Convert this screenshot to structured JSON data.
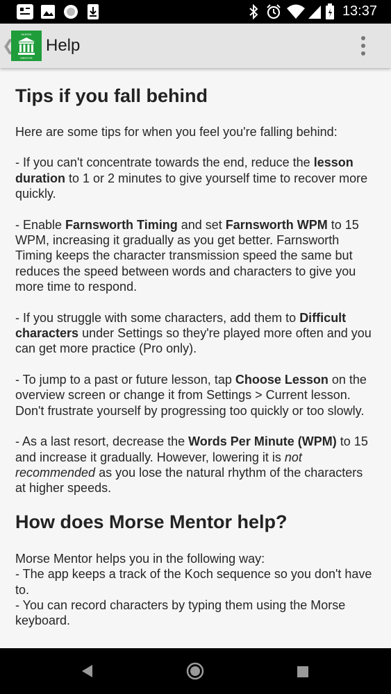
{
  "status_bar": {
    "time": "13:37",
    "left_icons": [
      "notification-app-icon",
      "image-icon",
      "circle-icon",
      "download-icon"
    ],
    "right_icons": [
      "bluetooth-icon",
      "alarm-icon",
      "wifi-icon",
      "signal-icon",
      "battery-icon"
    ]
  },
  "app_bar": {
    "title": "Help",
    "logo_text_top": "MORSE",
    "logo_text_bottom": "MENTOR"
  },
  "article": {
    "tips_heading": "Tips if you fall behind",
    "tips_intro": "Here are some tips for when you feel you're falling behind:",
    "tip1": {
      "before": "- If you can't concentrate towards the end, reduce the ",
      "bold": "lesson duration",
      "after": " to 1 or 2 minutes to give yourself time to recover more quickly."
    },
    "tip2": {
      "before": "- Enable ",
      "bold1": "Farnsworth Timing",
      "middle": " and set ",
      "bold2": "Farnsworth WPM",
      "after": " to 15 WPM, increasing it gradually as you get better. Farnsworth Timing keeps the character transmission speed the same but reduces the speed between words and characters to give you more time to respond."
    },
    "tip3": {
      "before": "- If you struggle with some characters, add them to ",
      "bold": "Difficult characters",
      "after": " under Settings so they're played more often and you can get more practice (Pro only)."
    },
    "tip4": {
      "before": "- To jump to a past or future lesson, tap ",
      "bold": "Choose Lesson",
      "after": " on the overview screen or change it from Settings > Current lesson. Don't frustrate yourself by progressing too quickly or too slowly."
    },
    "tip5": {
      "before": "- As a last resort, decrease the ",
      "bold": "Words Per Minute (WPM)",
      "middle": " to 15 and increase it gradually. However, lowering it is ",
      "italic": "not recommended",
      "after": " as you lose the natural rhythm of the characters at higher speeds."
    },
    "help_heading": "How does Morse Mentor help?",
    "help_line1": "Morse Mentor helps you in the following way:",
    "help_line2": "- The app keeps a track of the Koch sequence so you don't have to.",
    "help_line3": "- You can record characters by typing them using the Morse keyboard."
  },
  "nav_bar": {
    "buttons": [
      "back-button",
      "home-button",
      "recents-button"
    ]
  }
}
